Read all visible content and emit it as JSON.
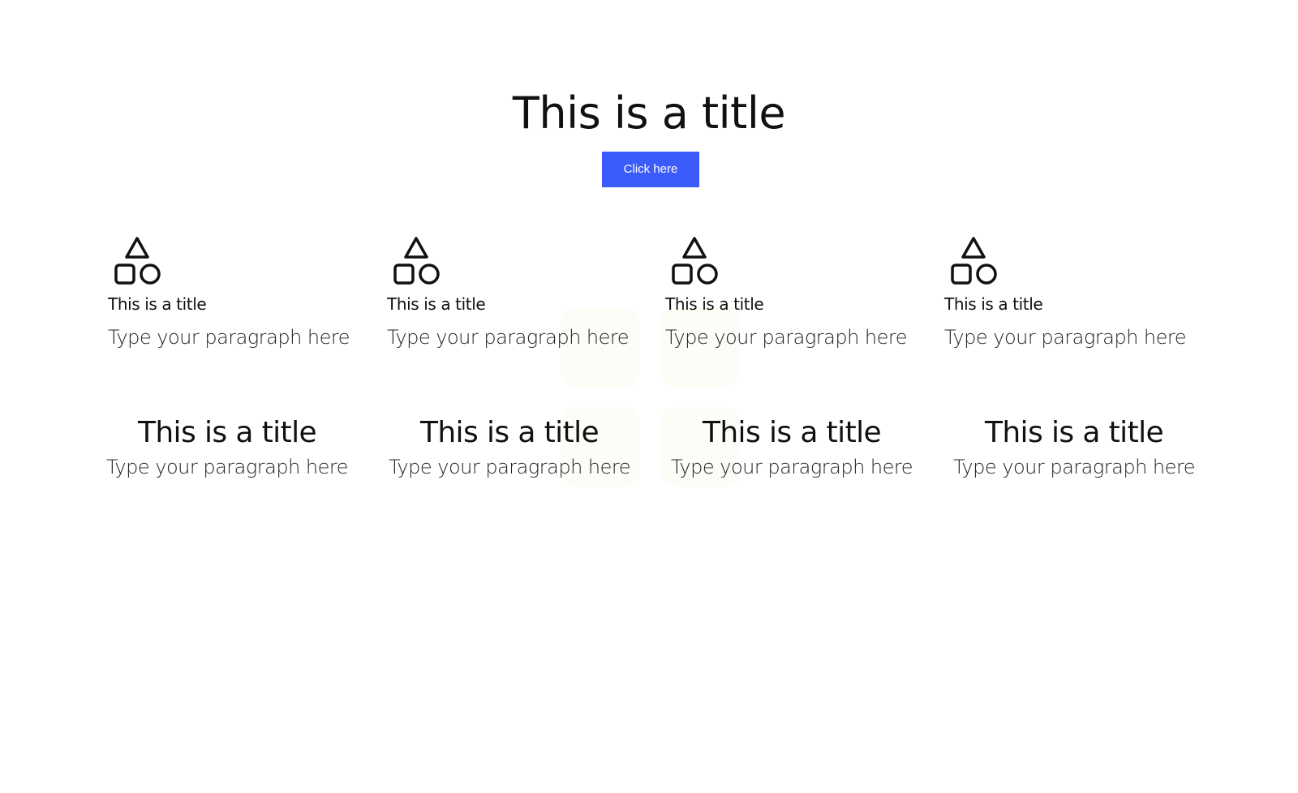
{
  "hero": {
    "title": "This is a title",
    "button_label": "Click here",
    "button_color": "#3b5bfb"
  },
  "features": [
    {
      "icon": "shapes-icon",
      "title": "This is a title",
      "text": "Type your paragraph here"
    },
    {
      "icon": "shapes-icon",
      "title": "This is a title",
      "text": "Type your paragraph here"
    },
    {
      "icon": "shapes-icon",
      "title": "This is a title",
      "text": "Type your paragraph here"
    },
    {
      "icon": "shapes-icon",
      "title": "This is a title",
      "text": "Type your paragraph here"
    }
  ],
  "stats": [
    {
      "title": "This is a title",
      "text": "Type your paragraph here"
    },
    {
      "title": "This is a title",
      "text": "Type your paragraph here"
    },
    {
      "title": "This is a title",
      "text": "Type your paragraph here"
    },
    {
      "title": "This is a title",
      "text": "Type your paragraph here"
    }
  ]
}
